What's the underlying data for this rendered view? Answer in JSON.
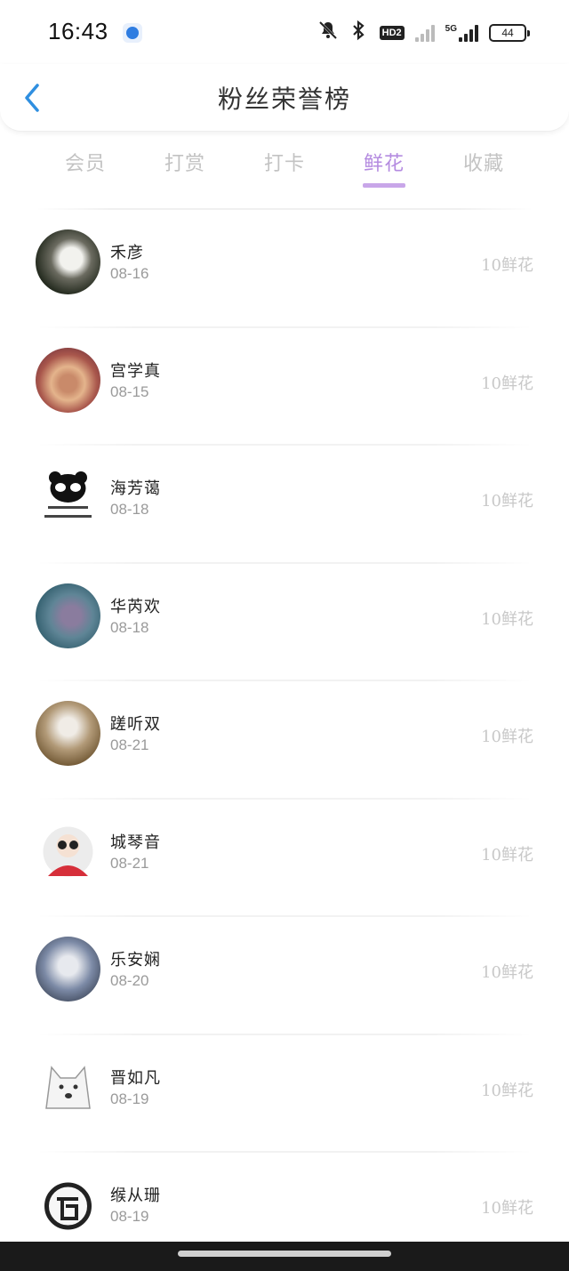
{
  "status_bar": {
    "time": "16:43",
    "network_label": "5G",
    "battery": "44",
    "icons": [
      "app-notification-icon",
      "mute-bell-icon",
      "bluetooth-icon",
      "hd-voice-icon",
      "signal-sim1-icon",
      "signal-sim2-icon",
      "battery-icon"
    ],
    "hd_label": "HD2"
  },
  "nav": {
    "title": "粉丝荣誉榜",
    "back_icon": "chevron-left-icon",
    "accent_color": "#2f8fe0"
  },
  "tabs": [
    {
      "label": "会员",
      "active": false
    },
    {
      "label": "打赏",
      "active": false
    },
    {
      "label": "打卡",
      "active": false
    },
    {
      "label": "鲜花",
      "active": true
    },
    {
      "label": "收藏",
      "active": false
    }
  ],
  "tab_active_color": "#b48be0",
  "fans": [
    {
      "name": "禾彦",
      "date": "08-16",
      "count": "10鲜花"
    },
    {
      "name": "宫学真",
      "date": "08-15",
      "count": "10鲜花"
    },
    {
      "name": "海芳蔼",
      "date": "08-18",
      "count": "10鲜花"
    },
    {
      "name": "华芮欢",
      "date": "08-18",
      "count": "10鲜花"
    },
    {
      "name": "蹉听双",
      "date": "08-21",
      "count": "10鲜花"
    },
    {
      "name": "城琴音",
      "date": "08-21",
      "count": "10鲜花"
    },
    {
      "name": "乐安娴",
      "date": "08-20",
      "count": "10鲜花"
    },
    {
      "name": "晋如凡",
      "date": "08-19",
      "count": "10鲜花"
    },
    {
      "name": "缑从珊",
      "date": "08-19",
      "count": "10鲜花"
    }
  ]
}
